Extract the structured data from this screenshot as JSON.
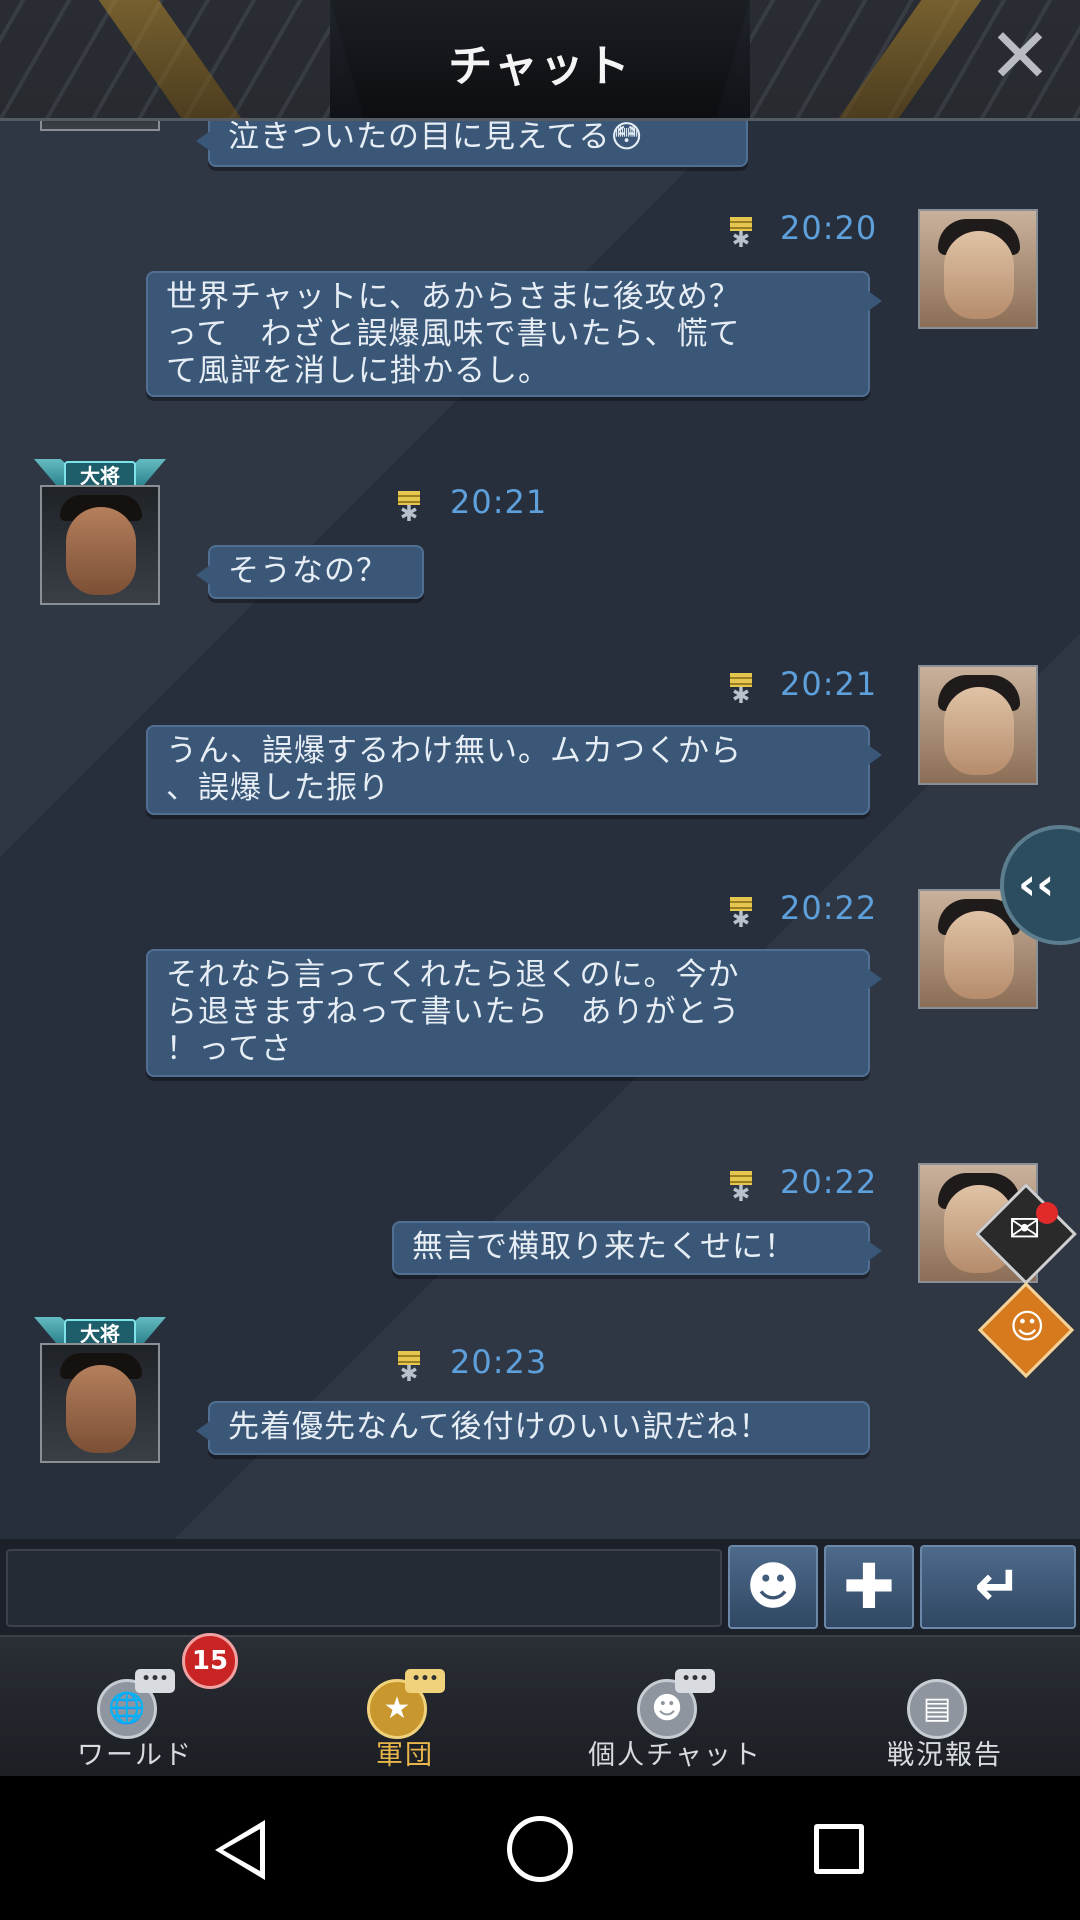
{
  "header": {
    "title": "チャット",
    "close_icon": "close-icon"
  },
  "messages": [
    {
      "id": "m0",
      "side": "left",
      "text": "泣きついたの目に見えてる😳",
      "time": ""
    },
    {
      "id": "m1",
      "side": "right",
      "time": "20:20",
      "lines": [
        "世界チャットに、あからさまに後攻め？",
        "って　わざと誤爆風味で書いたら、慌て",
        "て風評を消しに掛かるし。"
      ]
    },
    {
      "id": "m2",
      "side": "left",
      "rank": "大将",
      "time": "20:21",
      "text": "そうなの？"
    },
    {
      "id": "m3",
      "side": "right",
      "time": "20:21",
      "lines": [
        "うん、誤爆するわけ無い。ムカつくから",
        "、誤爆した振り"
      ]
    },
    {
      "id": "m4",
      "side": "right",
      "time": "20:22",
      "lines": [
        "それなら言ってくれたら退くのに。今か",
        "ら退きますねって書いたら　ありがとう",
        "！ってさ"
      ]
    },
    {
      "id": "m5",
      "side": "right",
      "time": "20:22",
      "text": "無言で横取り来たくせに！"
    },
    {
      "id": "m6",
      "side": "left",
      "rank": "大将",
      "time": "20:23",
      "text": "先着優先なんて後付けのいい訳だね！"
    }
  ],
  "side_tab": {
    "label": "‹‹"
  },
  "input": {
    "value": "",
    "placeholder": ""
  },
  "buttons": {
    "emoji": "☻",
    "plus": "✚",
    "send": "↵"
  },
  "nav": [
    {
      "label": "ワールド",
      "icon": "world-chat-icon",
      "badge": "15",
      "active": false
    },
    {
      "label": "軍団",
      "icon": "legion-chat-icon",
      "active": true
    },
    {
      "label": "個人チャット",
      "icon": "personal-chat-icon",
      "active": false
    },
    {
      "label": "戦況報告",
      "icon": "battle-report-icon",
      "active": false
    }
  ],
  "colors": {
    "bubble": "#3a5777",
    "time": "#5ea0dc",
    "active_nav": "#e8b64a",
    "badge": "#c92424"
  }
}
